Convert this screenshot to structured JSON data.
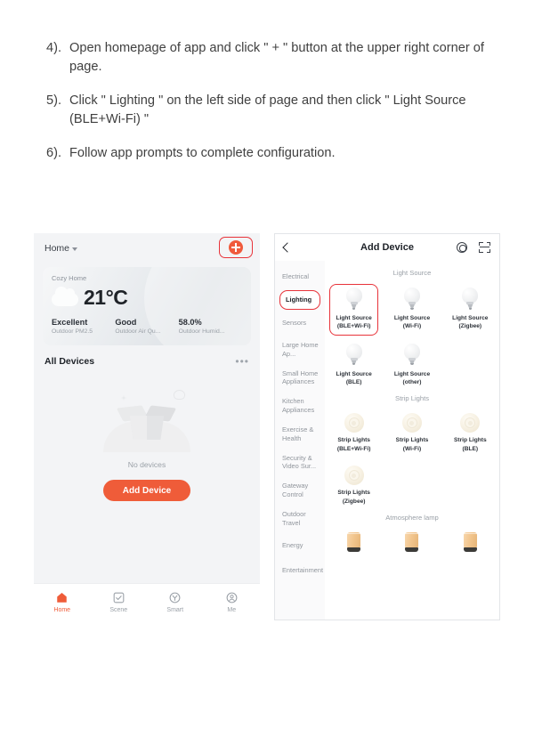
{
  "instructions": [
    {
      "num": "4).",
      "text": "Open homepage of app and click \" + \" button at the upper right corner of page."
    },
    {
      "num": "5).",
      "text": "Click \" Lighting \" on the left side of page and then click \" Light Source (BLE+Wi-Fi) \""
    },
    {
      "num": "6).",
      "text": "Follow app prompts to complete configuration."
    }
  ],
  "colors": {
    "accent_orange": "#ef5c39",
    "highlight_red": "#e8333a",
    "text_dark": "#20242a",
    "text_muted": "#9aa0a7"
  },
  "home_screen": {
    "home_selector": "Home",
    "add_button_label": "+",
    "weather_card": {
      "home_name": "Cozy Home",
      "temperature": "21°C",
      "weather_icon": "cloud-icon",
      "stats": [
        {
          "value": "Excellent",
          "label": "Outdoor PM2.5"
        },
        {
          "value": "Good",
          "label": "Outdoor Air Qu..."
        },
        {
          "value": "58.0%",
          "label": "Outdoor Humid..."
        }
      ],
      "page_dots": 2,
      "active_dot": 0
    },
    "devices_section": {
      "title": "All Devices",
      "more_label": "•••",
      "empty_text": "No devices",
      "add_device_button": "Add Device"
    },
    "tabs": [
      {
        "label": "Home",
        "icon": "house-icon",
        "active": true
      },
      {
        "label": "Scene",
        "icon": "checkbox-icon",
        "active": false
      },
      {
        "label": "Smart",
        "icon": "smart-circle-icon",
        "active": false
      },
      {
        "label": "Me",
        "icon": "person-circle-icon",
        "active": false
      }
    ]
  },
  "add_device_screen": {
    "back_icon": "chevron-left-icon",
    "title": "Add Device",
    "header_icons": [
      {
        "name": "target-scan-icon"
      },
      {
        "name": "qr-scan-icon"
      }
    ],
    "categories": [
      {
        "label": "Electrical",
        "selected": false
      },
      {
        "label": "Lighting",
        "selected": true
      },
      {
        "label": "Sensors",
        "selected": false
      },
      {
        "label": "Large Home Ap...",
        "selected": false
      },
      {
        "label": "Small Home Appliances",
        "selected": false
      },
      {
        "label": "Kitchen Appliances",
        "selected": false
      },
      {
        "label": "Exercise & Health",
        "selected": false
      },
      {
        "label": "Security & Video Sur...",
        "selected": false
      },
      {
        "label": "Gateway Control",
        "selected": false
      },
      {
        "label": "Outdoor Travel",
        "selected": false
      },
      {
        "label": "Energy",
        "selected": false
      },
      {
        "label": "Entertainment",
        "selected": false
      }
    ],
    "sections": [
      {
        "title": "Light Source",
        "icon": "bulb",
        "items": [
          {
            "line1": "Light Source",
            "line2": "(BLE+Wi-Fi)",
            "highlighted": true
          },
          {
            "line1": "Light Source",
            "line2": "(Wi-Fi)",
            "highlighted": false
          },
          {
            "line1": "Light Source",
            "line2": "(Zigbee)",
            "highlighted": false
          },
          {
            "line1": "Light Source",
            "line2": "(BLE)",
            "highlighted": false
          },
          {
            "line1": "Light Source",
            "line2": "(other)",
            "highlighted": false
          }
        ]
      },
      {
        "title": "Strip Lights",
        "icon": "coil",
        "items": [
          {
            "line1": "Strip Lights",
            "line2": "(BLE+Wi-Fi)",
            "highlighted": false
          },
          {
            "line1": "Strip Lights",
            "line2": "(Wi-Fi)",
            "highlighted": false
          },
          {
            "line1": "Strip Lights",
            "line2": "(BLE)",
            "highlighted": false
          },
          {
            "line1": "Strip Lights",
            "line2": "(Zigbee)",
            "highlighted": false
          }
        ]
      },
      {
        "title": "Atmosphere lamp",
        "icon": "lamp",
        "items": [
          {
            "line1": "",
            "line2": "",
            "highlighted": false
          },
          {
            "line1": "",
            "line2": "",
            "highlighted": false
          },
          {
            "line1": "",
            "line2": "",
            "highlighted": false
          }
        ]
      }
    ]
  }
}
